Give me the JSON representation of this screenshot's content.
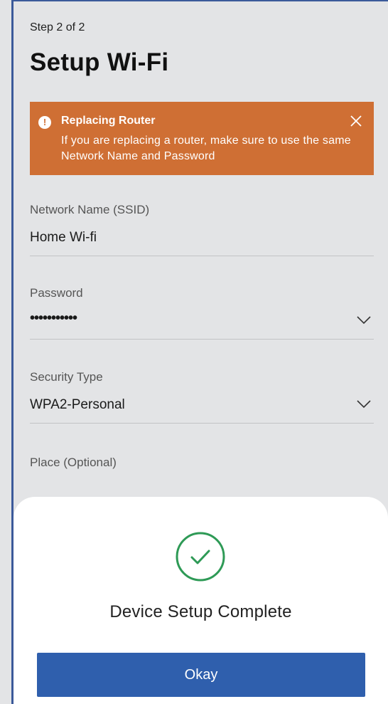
{
  "header": {
    "step": "Step 2 of 2",
    "title": "Setup Wi-Fi"
  },
  "banner": {
    "icon": "exclamation-circle-icon",
    "title": "Replacing Router",
    "message": "If you are replacing a router, make sure to use the same Network Name and Password",
    "close_icon": "close-icon",
    "color": "#cf6f34"
  },
  "form": {
    "network_name": {
      "label": "Network Name (SSID)",
      "value": "Home Wi-fi"
    },
    "password": {
      "label": "Password",
      "value": "•••••••••••",
      "icon": "chevron-down-icon"
    },
    "security_type": {
      "label": "Security Type",
      "value": "WPA2-Personal",
      "icon": "chevron-down-icon"
    },
    "place": {
      "label": "Place (Optional)"
    }
  },
  "dialog": {
    "icon": "check-circle-icon",
    "message": "Device Setup Complete",
    "button_label": "Okay",
    "success_color": "#2e9a56",
    "button_color": "#2f5fad"
  }
}
